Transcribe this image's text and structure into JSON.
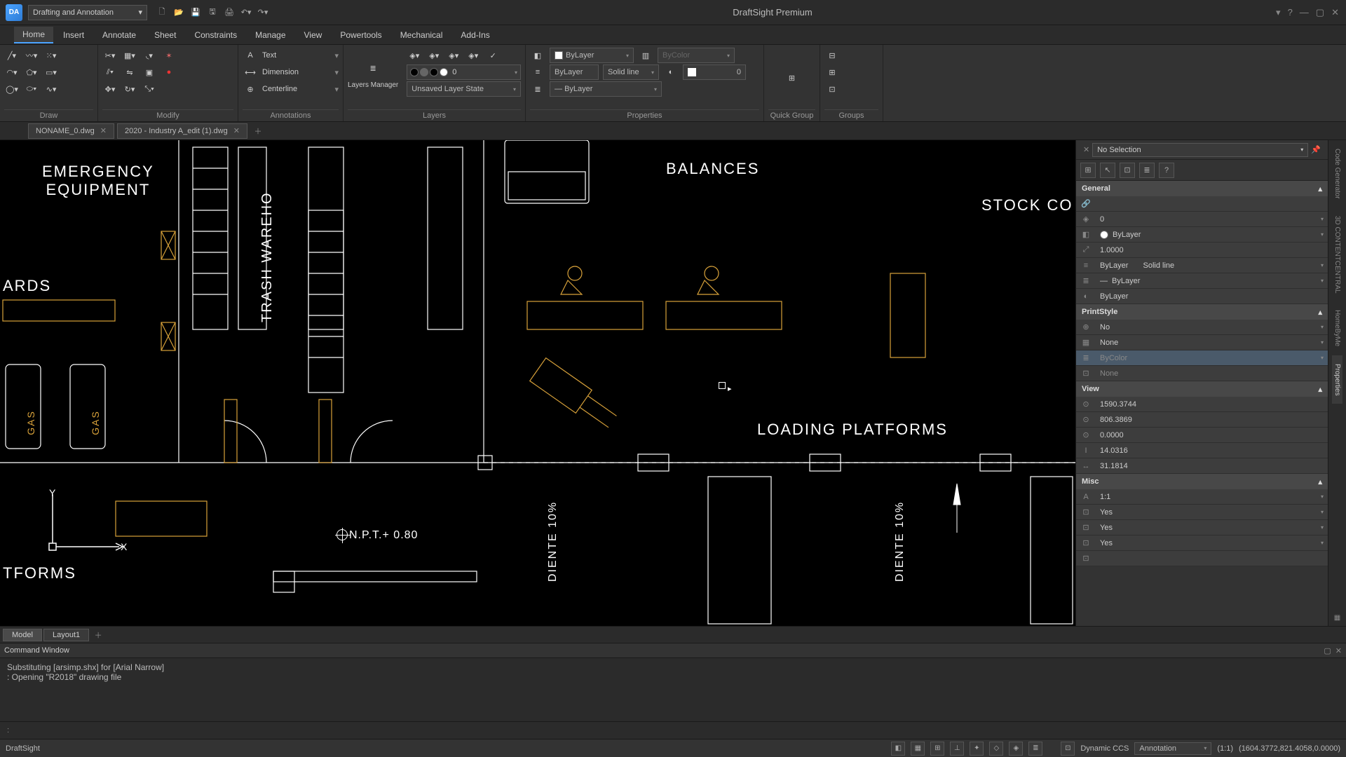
{
  "app": {
    "title": "DraftSight Premium",
    "logo_text": "DA"
  },
  "workspace": "Drafting and Annotation",
  "menu": [
    "Home",
    "Insert",
    "Annotate",
    "Sheet",
    "Constraints",
    "Manage",
    "View",
    "Powertools",
    "Mechanical",
    "Add-Ins"
  ],
  "menu_active": 0,
  "ribbon": {
    "panels": [
      "Draw",
      "Modify",
      "Annotations",
      "Layers",
      "Properties",
      "Quick Group",
      "Groups"
    ],
    "annotations": {
      "text": "Text",
      "dimension": "Dimension",
      "centerline": "Centerline"
    },
    "layers": {
      "manager": "Layers Manager",
      "state": "Unsaved Layer State"
    },
    "properties": {
      "color": "ByLayer",
      "linetype_layer": "ByLayer",
      "linetype": "Solid line",
      "lineweight": "ByLayer",
      "bycolor": "ByColor",
      "zero": "0"
    },
    "quick_group": "Quick Group"
  },
  "doctabs": [
    {
      "name": "NONAME_0.dwg"
    },
    {
      "name": "2020 - Industry A_edit (1).dwg"
    }
  ],
  "canvas": {
    "labels": {
      "emergency": "EMERGENCY\nEQUIPMENT",
      "trash": "TRASH WAREHO",
      "balances": "BALANCES",
      "stock": "STOCK CO",
      "ards": "ARDS",
      "loading": "LOADING  PLATFORMS",
      "tforms": "TFORMS",
      "npt": "N.P.T.+ 0.80",
      "gas": "GAS",
      "diente": "DIENTE 10%",
      "x": "X",
      "y": "Y"
    }
  },
  "properties_panel": {
    "selection": "No Selection",
    "sections": {
      "general": "General",
      "printstyle": "PrintStyle",
      "view": "View",
      "misc": "Misc"
    },
    "general": {
      "layer": "0",
      "color": "ByLayer",
      "scale": "1.0000",
      "linetype_l": "ByLayer",
      "linetype_r": "Solid line",
      "lineweight": "ByLayer",
      "transparency": "ByLayer"
    },
    "printstyle": {
      "display": "No",
      "style": "None",
      "table": "ByColor",
      "attached": "None"
    },
    "view": {
      "x": "1590.3744",
      "y": "806.3869",
      "z": "0.0000",
      "h": "14.0316",
      "w": "31.1814"
    },
    "misc": {
      "scale": "1:1",
      "v1": "Yes",
      "v2": "Yes",
      "v3": "Yes"
    }
  },
  "layouttabs": [
    "Model",
    "Layout1"
  ],
  "cmdwin": {
    "title": "Command Window",
    "line1": "Substituting [arsimp.shx] for [Arial Narrow]",
    "line2": ": Opening \"R2018\" drawing file",
    "prompt": ":"
  },
  "status": {
    "brand": "DraftSight",
    "dyn": "Dynamic CCS",
    "anno": "Annotation",
    "scale": "(1:1)",
    "coords": "(1604.3772,821.4058,0.0000)"
  },
  "sidetabs": [
    "Code Generator",
    "3D CONTENTCENTRAL",
    "HomeByMe",
    "Properties"
  ]
}
